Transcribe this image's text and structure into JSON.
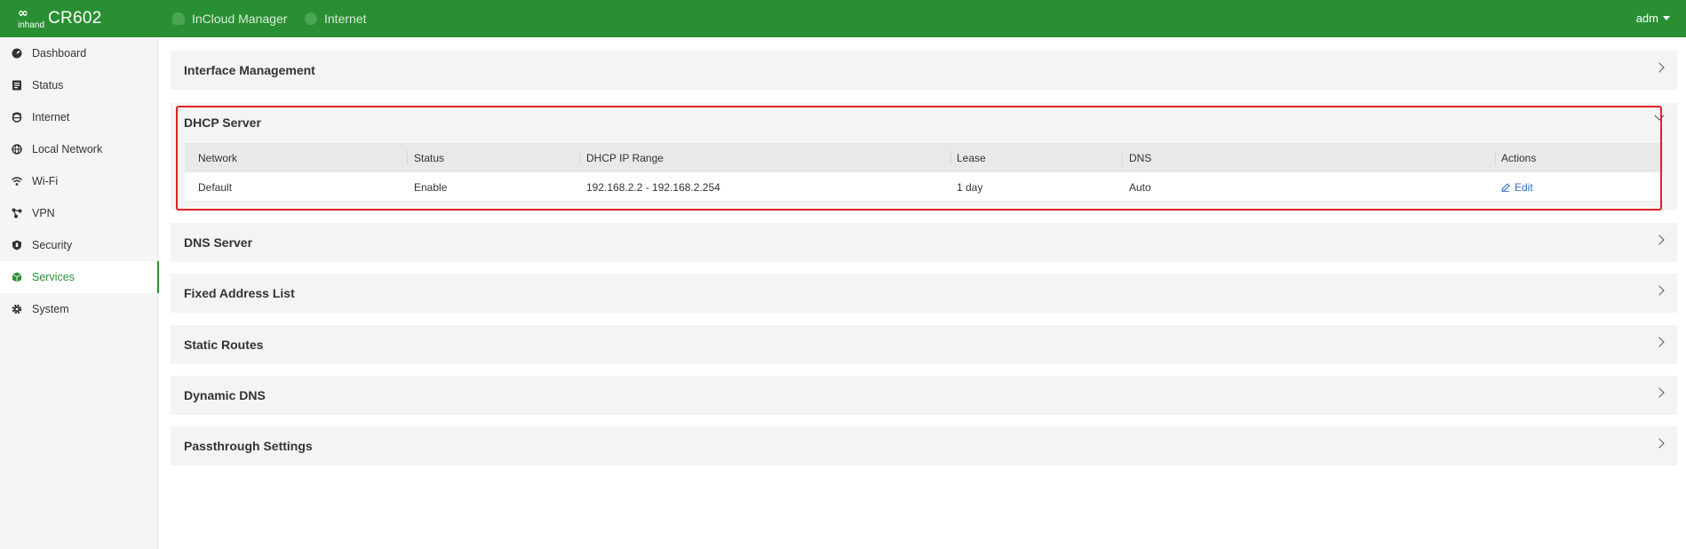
{
  "header": {
    "logo_mark": "∞",
    "logo_brand": "inhand",
    "model": "CR602",
    "incloud_label": "InCloud Manager",
    "internet_label": "Internet",
    "user": "adm",
    "bg_color": "#2a8f33"
  },
  "sidebar": {
    "items": [
      {
        "label": "Dashboard",
        "icon": "dashboard-icon"
      },
      {
        "label": "Status",
        "icon": "status-icon"
      },
      {
        "label": "Internet",
        "icon": "internet-icon"
      },
      {
        "label": "Local Network",
        "icon": "globe-icon"
      },
      {
        "label": "Wi-Fi",
        "icon": "wifi-icon"
      },
      {
        "label": "VPN",
        "icon": "vpn-icon"
      },
      {
        "label": "Security",
        "icon": "shield-icon"
      },
      {
        "label": "Services",
        "icon": "cube-icon",
        "active": true
      },
      {
        "label": "System",
        "icon": "gear-icon"
      }
    ],
    "active_color": "#2a8f33"
  },
  "panels": [
    {
      "title": "Interface Management",
      "expanded": false
    },
    {
      "title": "DHCP Server",
      "expanded": true
    },
    {
      "title": "DNS Server",
      "expanded": false
    },
    {
      "title": "Fixed Address List",
      "expanded": false
    },
    {
      "title": "Static Routes",
      "expanded": false
    },
    {
      "title": "Dynamic DNS",
      "expanded": false
    },
    {
      "title": "Passthrough Settings",
      "expanded": false
    }
  ],
  "dhcp_table": {
    "columns": [
      "Network",
      "Status",
      "DHCP IP Range",
      "Lease",
      "DNS",
      "Actions"
    ],
    "rows": [
      {
        "network": "Default",
        "status": "Enable",
        "range": "192.168.2.2 - 192.168.2.254",
        "lease": "1 day",
        "dns": "Auto",
        "action": "Edit"
      }
    ]
  },
  "highlight_color": "#e02323"
}
